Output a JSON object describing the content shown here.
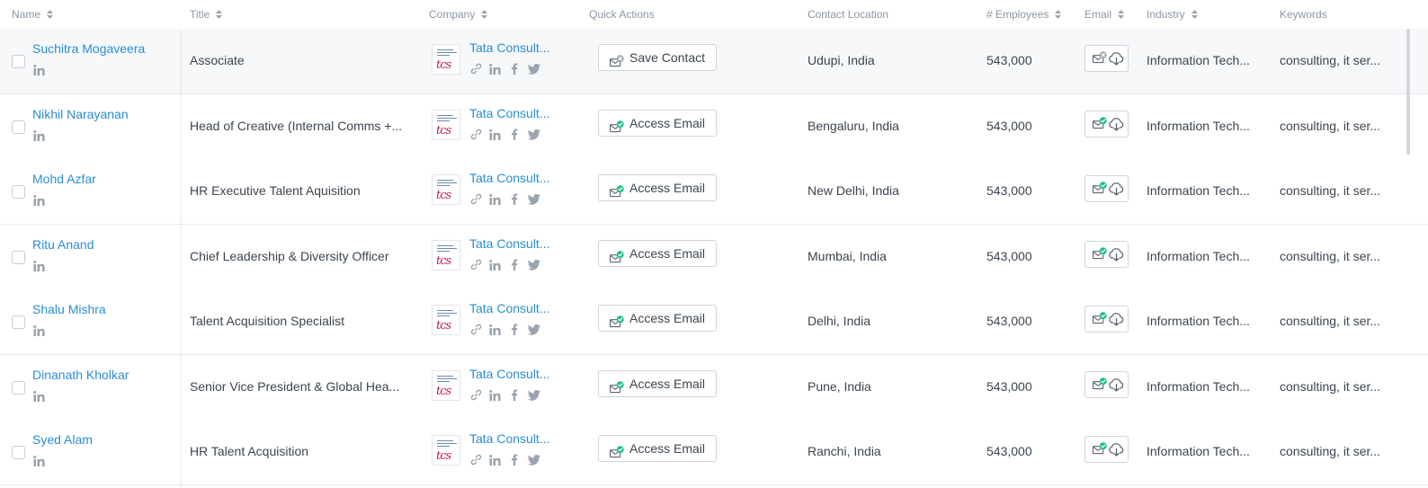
{
  "headers": {
    "name": "Name",
    "title": "Title",
    "company": "Company",
    "quick_actions": "Quick Actions",
    "contact_location": "Contact Location",
    "employees": "# Employees",
    "email": "Email",
    "industry": "Industry",
    "keywords": "Keywords"
  },
  "colors": {
    "link": "#2a8ed4",
    "email_ok": "#1fbf8a",
    "email_none": "#9aa4ae"
  },
  "rows": [
    {
      "name": "Suchitra Mogaveera",
      "title": "Associate",
      "company": "Tata Consult...",
      "action": "Save Contact",
      "location": "Udupi, India",
      "employees": "543,000",
      "industry": "Information Tech...",
      "keywords": "consulting,  it ser...",
      "email_status": "unavailable"
    },
    {
      "name": "Nikhil Narayanan",
      "title": "Head of Creative (Internal Comms +...",
      "company": "Tata Consult...",
      "action": "Access Email",
      "location": "Bengaluru, India",
      "employees": "543,000",
      "industry": "Information Tech...",
      "keywords": "consulting,  it ser...",
      "email_status": "verified"
    },
    {
      "name": "Mohd Azfar",
      "title": "HR Executive Talent Aquisition",
      "company": "Tata Consult...",
      "action": "Access Email",
      "location": "New Delhi, India",
      "employees": "543,000",
      "industry": "Information Tech...",
      "keywords": "consulting,  it ser...",
      "email_status": "verified"
    },
    {
      "name": "Ritu Anand",
      "title": "Chief Leadership & Diversity Officer",
      "company": "Tata Consult...",
      "action": "Access Email",
      "location": "Mumbai, India",
      "employees": "543,000",
      "industry": "Information Tech...",
      "keywords": "consulting,  it ser...",
      "email_status": "verified"
    },
    {
      "name": "Shalu Mishra",
      "title": "Talent Acquisition Specialist",
      "company": "Tata Consult...",
      "action": "Access Email",
      "location": "Delhi, India",
      "employees": "543,000",
      "industry": "Information Tech...",
      "keywords": "consulting,  it ser...",
      "email_status": "verified"
    },
    {
      "name": "Dinanath Kholkar",
      "title": "Senior Vice President & Global Hea...",
      "company": "Tata Consult...",
      "action": "Access Email",
      "location": "Pune, India",
      "employees": "543,000",
      "industry": "Information Tech...",
      "keywords": "consulting,  it ser...",
      "email_status": "verified"
    },
    {
      "name": "Syed Alam",
      "title": "HR Talent Acquisition",
      "company": "Tata Consult...",
      "action": "Access Email",
      "location": "Ranchi, India",
      "employees": "543,000",
      "industry": "Information Tech...",
      "keywords": "consulting,  it ser...",
      "email_status": "verified"
    }
  ]
}
